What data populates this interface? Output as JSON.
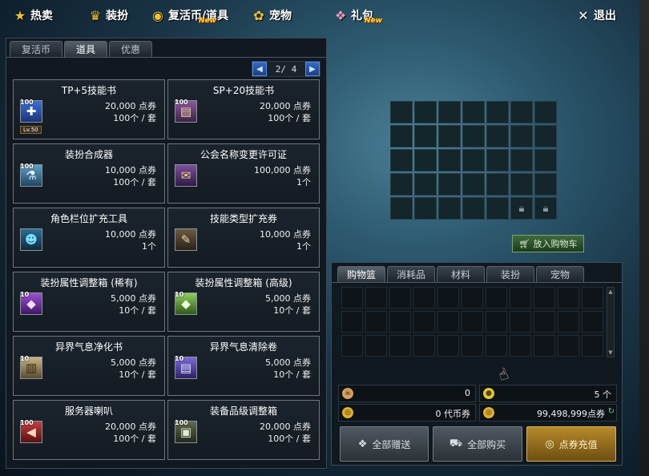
{
  "nav": {
    "hot_sale": "热卖",
    "costume": "装扮",
    "revive_coin_items": "复活币/道具",
    "revive_new": "New",
    "pet": "宠物",
    "gift_pack": "礼包",
    "gift_new": "New",
    "exit": "退出"
  },
  "left_tabs": [
    "复活币",
    "道具",
    "优惠"
  ],
  "pager": {
    "prev": "◀",
    "text": "2/ 4",
    "next": "▶"
  },
  "items": [
    {
      "name": "TP+5技能书",
      "price": "20,000 点券",
      "qty": "100个 / 套",
      "badge": "100",
      "level": "Lv.50",
      "icon": "skill-book-icon"
    },
    {
      "name": "SP+20技能书",
      "price": "20,000 点券",
      "qty": "100个 / 套",
      "badge": "100",
      "icon": "scroll-icon"
    },
    {
      "name": "装扮合成器",
      "price": "10,000 点券",
      "qty": "100个 / 套",
      "badge": "100",
      "icon": "synthesizer-icon"
    },
    {
      "name": "公会名称变更许可证",
      "price": "100,000 点券",
      "qty": "1个",
      "badge": "",
      "icon": "license-icon"
    },
    {
      "name": "角色栏位扩充工具",
      "price": "10,000 点券",
      "qty": "1个",
      "badge": "",
      "icon": "character-slot-icon"
    },
    {
      "name": "技能类型扩充券",
      "price": "10,000 点券",
      "qty": "1个",
      "badge": "",
      "icon": "skill-ticket-icon"
    },
    {
      "name": "装扮属性调整箱 (稀有)",
      "price": "5,000 点券",
      "qty": "10个 / 套",
      "badge": "10",
      "icon": "rare-box-icon"
    },
    {
      "name": "装扮属性调整箱 (高级)",
      "price": "5,000 点券",
      "qty": "10个 / 套",
      "badge": "10",
      "icon": "advanced-box-icon"
    },
    {
      "name": "异界气息净化书",
      "price": "5,000 点券",
      "qty": "10个 / 套",
      "badge": "10",
      "icon": "purify-book-icon"
    },
    {
      "name": "异界气息清除卷",
      "price": "5,000 点券",
      "qty": "10个 / 套",
      "badge": "10",
      "icon": "clear-scroll-icon"
    },
    {
      "name": "服务器喇叭",
      "price": "20,000 点券",
      "qty": "100个 / 套",
      "badge": "100",
      "icon": "horn-icon"
    },
    {
      "name": "装备品级调整箱",
      "price": "20,000 点券",
      "qty": "100个 / 套",
      "badge": "100",
      "icon": "grade-box-icon"
    }
  ],
  "preview": {
    "add_to_cart": "放入购物车"
  },
  "cart_tabs": [
    "购物篮",
    "消耗品",
    "材料",
    "装扮",
    "宠物"
  ],
  "stats": {
    "left_top_value": "0",
    "right_top_value": "5 个",
    "left_bottom_value": "0 代币券",
    "right_bottom_value": "99,498,999点券"
  },
  "buttons": {
    "gift_all": "全部赠送",
    "buy_all": "全部购买",
    "recharge": "点券充值"
  },
  "colors": {
    "accent_gold": "#f2c230",
    "recharge_gold": "#b58a2a",
    "new_tag": "#ffdd22"
  }
}
